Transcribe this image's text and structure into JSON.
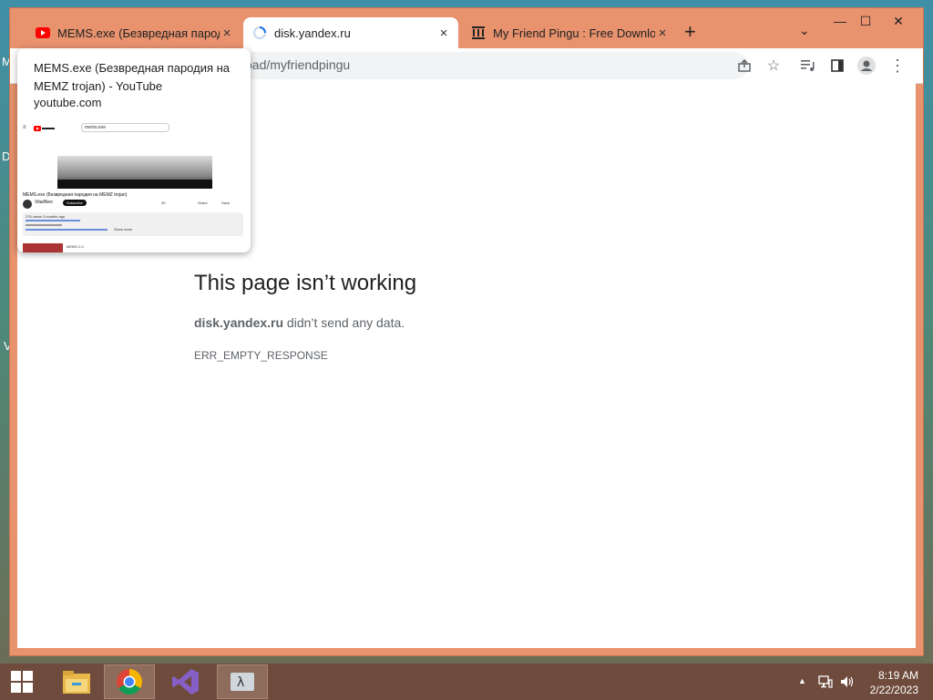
{
  "desktop": {
    "frag_m": "M",
    "frag_d": "D",
    "frag_v": "V"
  },
  "tabs": [
    {
      "title": "MEMS.exe (Безвредная пародия на MEMZ trojan) - YouTube"
    },
    {
      "title": "disk.yandex.ru"
    },
    {
      "title": "My Friend Pingu : Free Download, Borrow, and Streaming : Internet Archive"
    }
  ],
  "tab_close": "×",
  "new_tab": "+",
  "tab_search": "⌄",
  "window_controls": {
    "minimize": "—",
    "maximize": "☐",
    "close": "✕"
  },
  "omnibox": {
    "visible_text": "oad/myfriendpingu"
  },
  "toolbar_icons": {
    "share": "share-icon",
    "bookmark": "☆",
    "media": "media-control-icon",
    "side_panel": "side-panel-icon",
    "menu": "⋮"
  },
  "error": {
    "title": "This page isn’t working",
    "host": "disk.yandex.ru",
    "message_suffix": " didn’t send any data.",
    "code": "ERR_EMPTY_RESPONSE"
  },
  "hovercard": {
    "title": "MEMS.exe (Безвредная пародия на MEMZ trojan) - YouTube",
    "domain": "youtube.com",
    "thumb": {
      "search": "mems.exe",
      "video_title": "MEMS.exe (Безвредная пародия на MEMZ trojan)",
      "channel": "VitaliNeo",
      "subscribe": "Subscribe",
      "likes": "30",
      "share": "Share",
      "save": "Save",
      "desc_line1": "276 views 3 months ago",
      "desc_line3": "Show more",
      "sidebar_item": "MEMS 2.0"
    }
  },
  "taskbar": {
    "clock_time": "8:19 AM",
    "clock_date": "2/22/2023",
    "tray_chevron": "▲"
  },
  "colors": {
    "accent": "#e8926e",
    "taskbar": "#6e4b3c",
    "youtube_red": "#ff0000"
  }
}
